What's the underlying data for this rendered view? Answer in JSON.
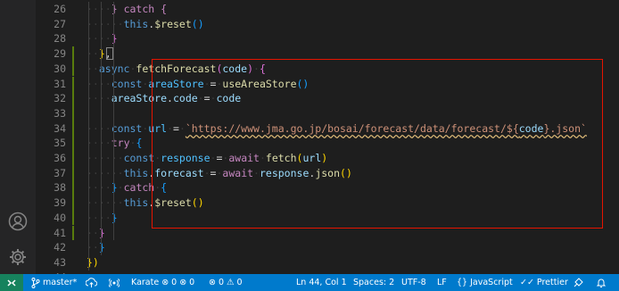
{
  "activity_bar": {
    "icons": [
      "account-icon",
      "gear-icon"
    ]
  },
  "editor": {
    "lines": [
      {
        "n": "26",
        "indent": 2,
        "tokens": [
          [
            "kw2",
            "} catch {"
          ]
        ]
      },
      {
        "n": "27",
        "indent": 3,
        "tokens": [
          [
            "this",
            "this"
          ],
          [
            "pl",
            "."
          ],
          [
            "fn",
            "$reset"
          ],
          [
            "b3",
            "()"
          ]
        ]
      },
      {
        "n": "28",
        "indent": 2,
        "tokens": [
          [
            "b2",
            "}"
          ]
        ]
      },
      {
        "n": "29",
        "indent": 1,
        "tokens": [
          [
            "b1",
            "}"
          ],
          [
            "pl",
            ","
          ]
        ]
      },
      {
        "n": "30",
        "indent": 1,
        "tokens": [
          [
            "kw",
            "async"
          ],
          [
            "ws",
            "·"
          ],
          [
            "fn",
            "fetchForecast"
          ],
          [
            "b2",
            "("
          ],
          [
            "var",
            "code"
          ],
          [
            "b2",
            ")"
          ],
          [
            "ws",
            "·"
          ],
          [
            "b2",
            "{"
          ]
        ]
      },
      {
        "n": "31",
        "indent": 2,
        "tokens": [
          [
            "kw",
            "const"
          ],
          [
            "ws",
            "·"
          ],
          [
            "cnst",
            "areaStore"
          ],
          [
            "ws",
            "·"
          ],
          [
            "pl",
            "="
          ],
          [
            "ws",
            "·"
          ],
          [
            "fn",
            "useAreaStore"
          ],
          [
            "b3",
            "()"
          ]
        ]
      },
      {
        "n": "32",
        "indent": 2,
        "tokens": [
          [
            "var",
            "areaStore"
          ],
          [
            "pl",
            "."
          ],
          [
            "var",
            "code"
          ],
          [
            "ws",
            "·"
          ],
          [
            "pl",
            "="
          ],
          [
            "ws",
            "·"
          ],
          [
            "var",
            "code"
          ]
        ]
      },
      {
        "n": "33",
        "indent": 0,
        "tokens": []
      },
      {
        "n": "34",
        "indent": 2,
        "tokens": [
          [
            "kw",
            "const"
          ],
          [
            "ws",
            "·"
          ],
          [
            "cnst",
            "url"
          ],
          [
            "ws",
            "·"
          ],
          [
            "pl",
            "="
          ],
          [
            "ws",
            "·"
          ],
          [
            "str",
            "`https://www.jma.go.jp/bosai/forecast/data/forecast/${"
          ],
          [
            "var",
            "code"
          ],
          [
            "str",
            "}.json`"
          ]
        ]
      },
      {
        "n": "35",
        "indent": 2,
        "tokens": [
          [
            "kw2",
            "try"
          ],
          [
            "ws",
            "·"
          ],
          [
            "b3",
            "{"
          ]
        ]
      },
      {
        "n": "36",
        "indent": 3,
        "tokens": [
          [
            "kw",
            "const"
          ],
          [
            "ws",
            "·"
          ],
          [
            "cnst",
            "response"
          ],
          [
            "ws",
            "·"
          ],
          [
            "pl",
            "="
          ],
          [
            "ws",
            "·"
          ],
          [
            "kw2",
            "await"
          ],
          [
            "ws",
            "·"
          ],
          [
            "fn",
            "fetch"
          ],
          [
            "b1",
            "("
          ],
          [
            "var",
            "url"
          ],
          [
            "b1",
            ")"
          ]
        ]
      },
      {
        "n": "37",
        "indent": 3,
        "tokens": [
          [
            "this",
            "this"
          ],
          [
            "pl",
            "."
          ],
          [
            "var",
            "forecast"
          ],
          [
            "ws",
            "·"
          ],
          [
            "pl",
            "="
          ],
          [
            "ws",
            "·"
          ],
          [
            "kw2",
            "await"
          ],
          [
            "ws",
            "·"
          ],
          [
            "var",
            "response"
          ],
          [
            "pl",
            "."
          ],
          [
            "fn",
            "json"
          ],
          [
            "b1",
            "()"
          ]
        ]
      },
      {
        "n": "38",
        "indent": 2,
        "tokens": [
          [
            "b3",
            "}"
          ],
          [
            "ws",
            "·"
          ],
          [
            "kw2",
            "catch"
          ],
          [
            "ws",
            "·"
          ],
          [
            "b3",
            "{"
          ]
        ]
      },
      {
        "n": "39",
        "indent": 3,
        "tokens": [
          [
            "this",
            "this"
          ],
          [
            "pl",
            "."
          ],
          [
            "fn",
            "$reset"
          ],
          [
            "b1",
            "()"
          ]
        ]
      },
      {
        "n": "40",
        "indent": 2,
        "tokens": [
          [
            "b3",
            "}"
          ]
        ]
      },
      {
        "n": "41",
        "indent": 1,
        "tokens": [
          [
            "b2",
            "}"
          ]
        ]
      },
      {
        "n": "42",
        "indent": 1,
        "tokens": [
          [
            "b3",
            "}"
          ]
        ]
      },
      {
        "n": "43",
        "indent": 0,
        "tokens": [
          [
            "b1",
            "})"
          ]
        ]
      },
      {
        "n": "44",
        "indent": 0,
        "tokens": []
      }
    ],
    "active_line": "44"
  },
  "status_bar": {
    "branch": "master*",
    "framework": "Karate",
    "errors_a": "0",
    "warnings_a": "0",
    "errors_b": "0",
    "warnings_b": "0",
    "cursor": "Ln 44, Col 1",
    "spaces": "Spaces: 2",
    "encoding": "UTF-8",
    "eol": "LF",
    "language": "JavaScript",
    "formatter": "Prettier"
  }
}
